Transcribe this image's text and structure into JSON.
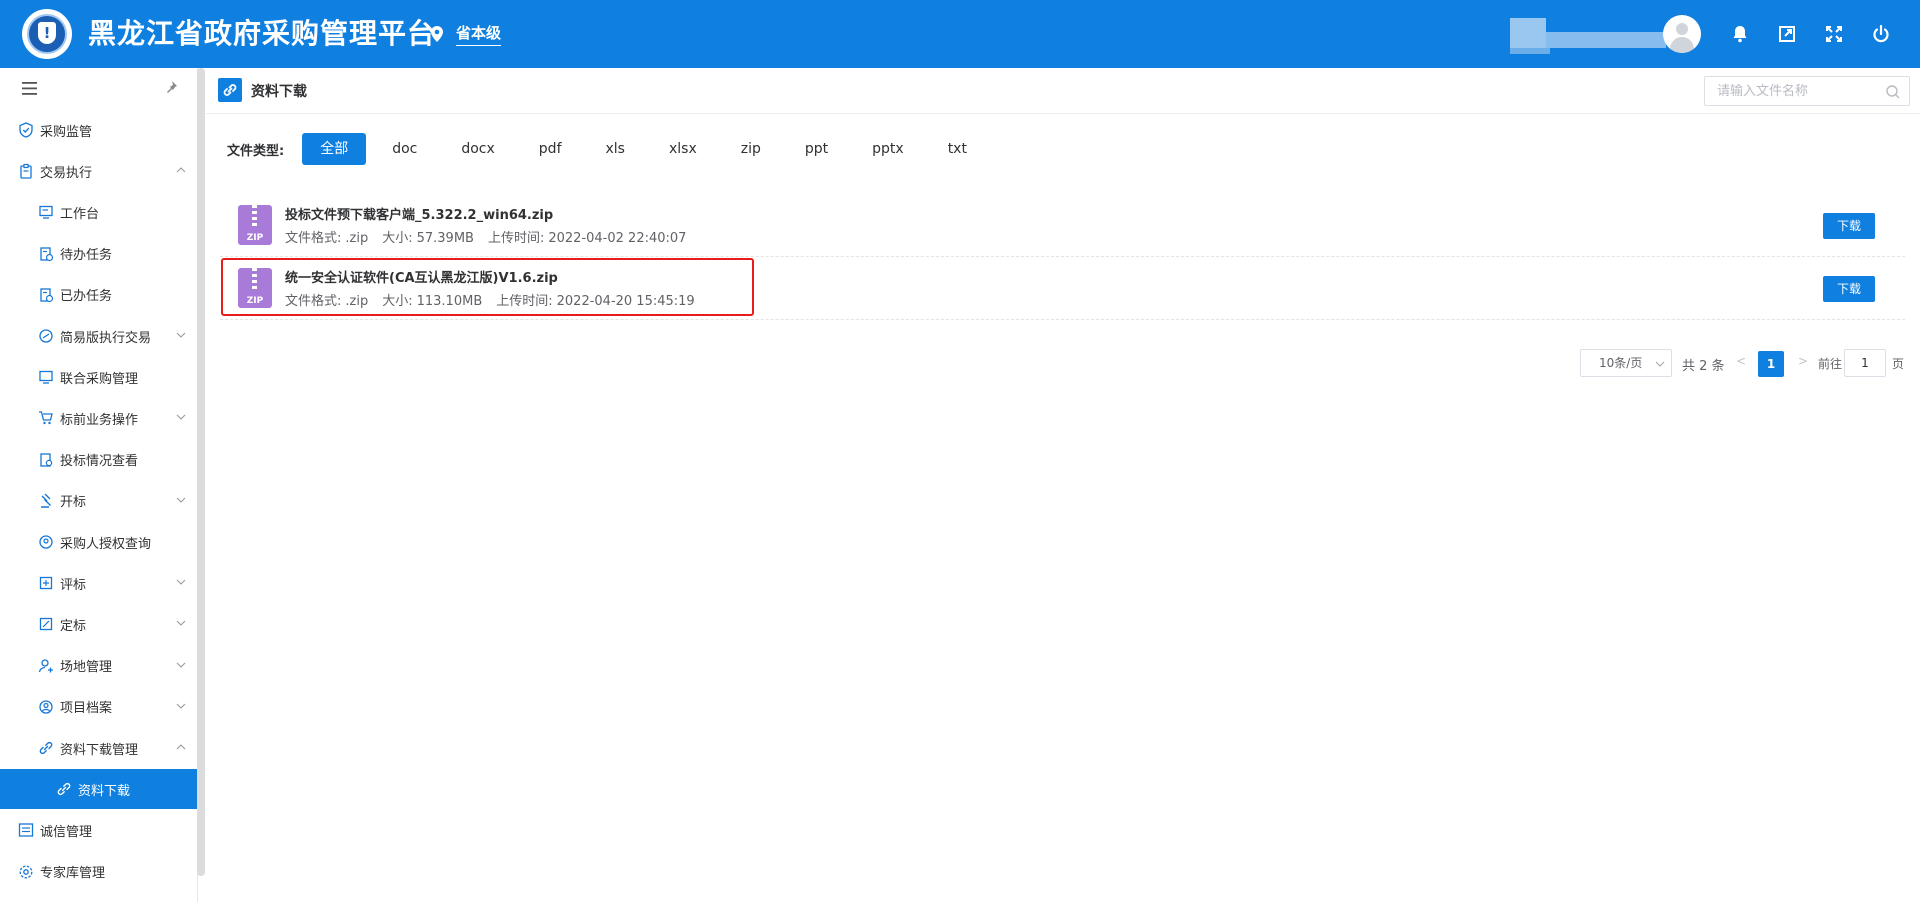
{
  "header": {
    "title": "黑龙江省政府采购管理平台",
    "region": "省本级",
    "logo_glyph": "!",
    "brand_color": "#0f7fe0",
    "icons": [
      "bell-icon",
      "external-window-icon",
      "fullscreen-icon",
      "power-icon"
    ]
  },
  "sidebar": {
    "items": [
      {
        "label": "采购监管",
        "icon": "shield-check-icon",
        "level": 1,
        "chevron": "none"
      },
      {
        "label": "交易执行",
        "icon": "clipboard-icon",
        "level": 1,
        "chevron": "up"
      },
      {
        "label": "工作台",
        "icon": "monitor-icon",
        "level": 2,
        "chevron": "none"
      },
      {
        "label": "待办任务",
        "icon": "task-pending-icon",
        "level": 2,
        "chevron": "none"
      },
      {
        "label": "已办任务",
        "icon": "task-done-icon",
        "level": 2,
        "chevron": "none"
      },
      {
        "label": "简易版执行交易",
        "icon": "simple-trade-icon",
        "level": 2,
        "chevron": "down"
      },
      {
        "label": "联合采购管理",
        "icon": "joint-purchase-icon",
        "level": 2,
        "chevron": "none"
      },
      {
        "label": "标前业务操作",
        "icon": "cart-icon",
        "level": 2,
        "chevron": "down"
      },
      {
        "label": "投标情况查看",
        "icon": "bid-view-icon",
        "level": 2,
        "chevron": "none"
      },
      {
        "label": "开标",
        "icon": "gavel-icon",
        "level": 2,
        "chevron": "down"
      },
      {
        "label": "采购人授权查询",
        "icon": "auth-query-icon",
        "level": 2,
        "chevron": "none"
      },
      {
        "label": "评标",
        "icon": "evaluate-icon",
        "level": 2,
        "chevron": "down"
      },
      {
        "label": "定标",
        "icon": "award-icon",
        "level": 2,
        "chevron": "down"
      },
      {
        "label": "场地管理",
        "icon": "venue-user-icon",
        "level": 2,
        "chevron": "down"
      },
      {
        "label": "项目档案",
        "icon": "archive-icon",
        "level": 2,
        "chevron": "down"
      },
      {
        "label": "资料下载管理",
        "icon": "link-icon",
        "level": 2,
        "chevron": "up"
      },
      {
        "label": "资料下载",
        "icon": "link-icon",
        "level": 3,
        "chevron": "none",
        "active": true
      },
      {
        "label": "诚信管理",
        "icon": "list-icon",
        "level": 1,
        "chevron": "none"
      },
      {
        "label": "专家库管理",
        "icon": "gear-icon",
        "level": 1,
        "chevron": "none"
      }
    ]
  },
  "main": {
    "page_title": "资料下载",
    "search_placeholder": "请输入文件名称",
    "filter_label": "文件类型:",
    "filter_tabs": [
      "全部",
      "doc",
      "docx",
      "pdf",
      "xls",
      "xlsx",
      "zip",
      "ppt",
      "pptx",
      "txt"
    ],
    "active_tab": "全部",
    "meta_labels": {
      "format": "文件格式:",
      "size": "大小:",
      "uploaded": "上传时间:"
    },
    "files": [
      {
        "name": "投标文件预下载客户端_5.322.2_win64.zip",
        "format": ".zip",
        "size": "57.39MB",
        "uploaded": "2022-04-02 22:40:07",
        "icon_text": "ZIP",
        "button": "下载"
      },
      {
        "name": "统一安全认证软件(CA互认黑龙江版)V1.6.zip",
        "format": ".zip",
        "size": "113.10MB",
        "uploaded": "2022-04-20 15:45:19",
        "icon_text": "ZIP",
        "button": "下载"
      }
    ],
    "pagination": {
      "page_size": "10条/页",
      "total": "共 2 条",
      "prev": "<",
      "current": "1",
      "next": ">",
      "goto_label": "前往",
      "goto_value": "1",
      "page_unit": "页"
    }
  }
}
